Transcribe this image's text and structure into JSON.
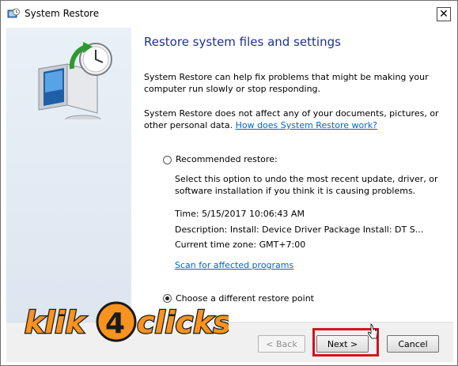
{
  "window": {
    "title": "System Restore",
    "close_glyph": "✕"
  },
  "content": {
    "heading": "Restore system files and settings",
    "para1": "System Restore can help fix problems that might be making your computer run slowly or stop responding.",
    "para2_text": "System Restore does not affect any of your documents, pictures, or other personal data.",
    "para2_link": "How does System Restore work?",
    "recommended": {
      "label": "Recommended restore:",
      "description": "Select this option to undo the most recent update, driver, or software installation if you think it is causing problems.",
      "time": "Time: 5/15/2017 10:06:43 AM",
      "description_line": "Description: Install: Device Driver Package Install: DT S...",
      "timezone": "Current time zone: GMT+7:00",
      "scan_link": "Scan for affected programs",
      "checked": false
    },
    "different": {
      "label": "Choose a different restore point",
      "checked": true
    }
  },
  "footer": {
    "back_label": "< Back",
    "next_label": "Next >",
    "cancel_label": "Cancel"
  },
  "watermark": {
    "text": "klik4clicks"
  },
  "icons": {
    "title_icon": "system-restore-icon",
    "hero_icon": "monitor-clock-restore-icon"
  },
  "colors": {
    "heading": "#1e3287",
    "link": "#0066cc",
    "highlight": "#d6121d",
    "watermark_orange": "#f7931e"
  }
}
